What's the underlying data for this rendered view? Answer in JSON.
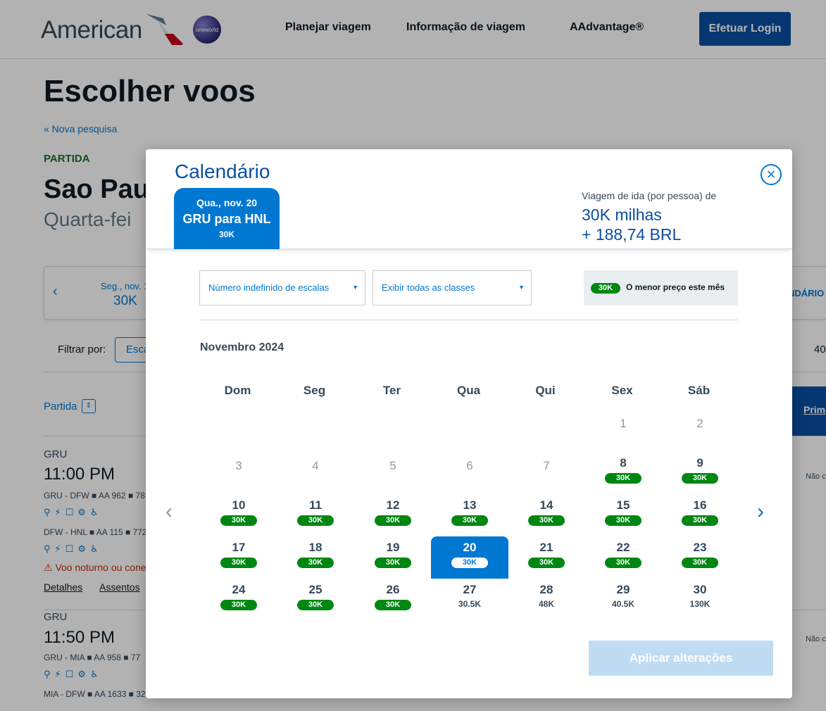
{
  "header": {
    "logo_text": "American",
    "oneworld": "oneworld",
    "nav": [
      "Planejar viagem",
      "Informação de viagem",
      "AAdvantage®"
    ],
    "login": "Efetuar Login"
  },
  "page": {
    "title": "Escolher voos",
    "new_search": "« Nova pesquisa",
    "partida": "PARTIDA",
    "city": "Sao Paul",
    "date_sub": "Quarta-fei",
    "strip_prev_day": "Seg., nov. 1",
    "strip_prev_price": "30K",
    "strip_calendar": "NDÁRIO",
    "filter_label": "Filtrar por:",
    "filter_btn": "Esca",
    "filter_right": "40",
    "sort_label": "Partida",
    "primeira": "Prime",
    "flights": [
      {
        "code": "GRU",
        "time": "11:00 PM",
        "seg1": "GRU - DFW ■ AA 962 ■ 78",
        "seg2": "DFW - HNL ■ AA 115 ■ 772",
        "warning": "⚠ Voo noturno ou cone",
        "details": "Detalhes",
        "seats": "Assentos",
        "nao": "Não c"
      },
      {
        "code": "GRU",
        "time": "11:50 PM",
        "seg1": "GRU - MIA ■ AA 958 ■ 77",
        "seg2": "MIA - DFW ■ AA 1633 ■ 32",
        "nao": "Não c"
      }
    ],
    "amenities": "⚲⚡☐⚙♿"
  },
  "modal": {
    "title": "Calendário",
    "selected_tab": {
      "date": "Qua., nov. 20",
      "route": "GRU para HNL",
      "price": "30K"
    },
    "trip_label": "Viagem de ida (por pessoa) de",
    "trip_miles": "30K milhas",
    "trip_brl": "+ 188,74 BRL",
    "stops_select": "Número indefinido de escalas",
    "class_select": "Exibir todas as classes",
    "legend_pill": "30K",
    "legend_text": "O menor preço este mês",
    "month": "Novembro 2024",
    "weekdays": [
      "Dom",
      "Seg",
      "Ter",
      "Qua",
      "Qui",
      "Sex",
      "Sáb"
    ],
    "apply": "Aplicar alterações",
    "days": [
      {
        "n": "1",
        "p": ""
      },
      {
        "n": "2",
        "p": ""
      },
      {
        "n": "3",
        "p": ""
      },
      {
        "n": "4",
        "p": ""
      },
      {
        "n": "5",
        "p": ""
      },
      {
        "n": "6",
        "p": ""
      },
      {
        "n": "7",
        "p": ""
      },
      {
        "n": "8",
        "p": "30K",
        "low": true
      },
      {
        "n": "9",
        "p": "30K",
        "low": true
      },
      {
        "n": "10",
        "p": "30K",
        "low": true
      },
      {
        "n": "11",
        "p": "30K",
        "low": true
      },
      {
        "n": "12",
        "p": "30K",
        "low": true
      },
      {
        "n": "13",
        "p": "30K",
        "low": true
      },
      {
        "n": "14",
        "p": "30K",
        "low": true
      },
      {
        "n": "15",
        "p": "30K",
        "low": true
      },
      {
        "n": "16",
        "p": "30K",
        "low": true
      },
      {
        "n": "17",
        "p": "30K",
        "low": true
      },
      {
        "n": "18",
        "p": "30K",
        "low": true
      },
      {
        "n": "19",
        "p": "30K",
        "low": true
      },
      {
        "n": "20",
        "p": "30K",
        "low": true,
        "selected": true
      },
      {
        "n": "21",
        "p": "30K",
        "low": true
      },
      {
        "n": "22",
        "p": "30K",
        "low": true
      },
      {
        "n": "23",
        "p": "30K",
        "low": true
      },
      {
        "n": "24",
        "p": "30K",
        "low": true
      },
      {
        "n": "25",
        "p": "30K",
        "low": true
      },
      {
        "n": "26",
        "p": "30K",
        "low": true
      },
      {
        "n": "27",
        "p": "30.5K"
      },
      {
        "n": "28",
        "p": "48K"
      },
      {
        "n": "29",
        "p": "40.5K"
      },
      {
        "n": "30",
        "p": "130K"
      }
    ]
  },
  "colors": {
    "brand_blue": "#0078d2",
    "dark_blue": "#0a4fa3",
    "price_green": "#008712"
  }
}
